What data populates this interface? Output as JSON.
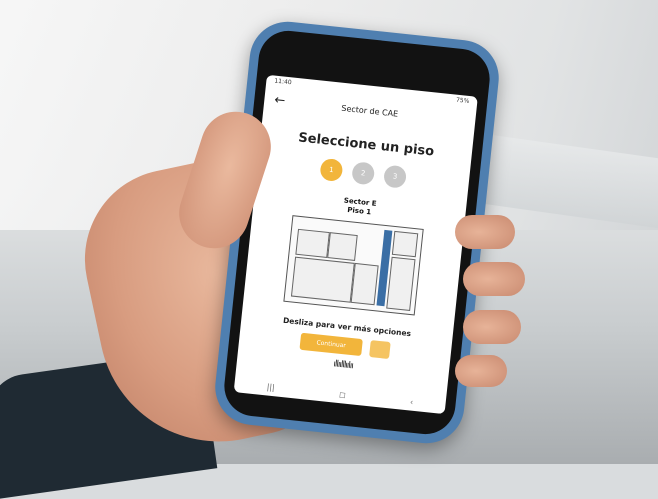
{
  "status": {
    "time": "11:40",
    "battery": "75%"
  },
  "app": {
    "title": "Sector de CAE",
    "heading": "Seleccione un piso",
    "steps": [
      "1",
      "2",
      "3"
    ],
    "sector_label": "Sector E",
    "floor_label": "Piso 1",
    "hint": "Desliza para ver más opciones",
    "button_label": "Continuar",
    "second_button_label": "",
    "wave_glyph": "ıllıılllıılıı",
    "nav": {
      "back": "|||",
      "home": "◻",
      "recent": "‹"
    }
  },
  "colors": {
    "accent": "#f2b53b",
    "case": "#4f7fb0"
  },
  "icons": [
    "back-arrow-icon",
    "audio-wave-icon"
  ]
}
